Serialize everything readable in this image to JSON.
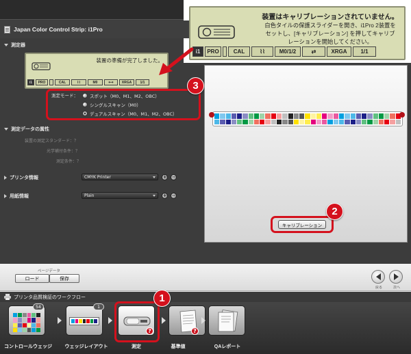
{
  "window": {
    "title": "Japan Color Control Strip: i1Pro"
  },
  "instrument": {
    "section_label": "測定器",
    "status_small": "装置の準備が完了しました。",
    "status_big_title": "装置はキャリブレーションされていません。",
    "status_big_body_1": "白色タイルの保護スライダーを開き、i1Pro 2装置を",
    "status_big_body_2": "セットし、[キャリブレーション] を押してキャリブ",
    "status_big_body_3": "レーションを開始してください。",
    "bar": {
      "model_short": "i1",
      "model": "PRO",
      "cal": "CAL",
      "m_mode": "M0",
      "m_mode_big": "M0/1/2",
      "xrga": "XRGA",
      "page": "1/1"
    }
  },
  "measurement_mode": {
    "label": "測定モード：",
    "options": [
      {
        "label": "スポット（M0、M1、M2、OBC）",
        "selected": false
      },
      {
        "label": "シングルスキャン（M0）",
        "selected": false
      },
      {
        "label": "デュアルスキャン（M0、M1、M2、OBC）",
        "selected": true
      }
    ]
  },
  "measurement_data": {
    "section_label": "測定データの属性",
    "rows": [
      "装置の測定スタンダード：？",
      "光学補付条件：？",
      "測定条件：？"
    ]
  },
  "printer": {
    "section_label": "プリンタ情報",
    "value": "CMYK Printer"
  },
  "paper": {
    "section_label": "用紙情報",
    "value": "Plain"
  },
  "calibrate_button": "キャリブレーション",
  "page_data": {
    "label": "ページデータ",
    "load": "ロード",
    "save": "保存"
  },
  "nav": {
    "back": "戻る",
    "next": "次へ"
  },
  "workflow": {
    "title": "プリンタ品質検証のワークフロー",
    "steps": [
      {
        "label": "コントロールウェッジ",
        "badge": "54"
      },
      {
        "label": "ウェッジレイアウト",
        "badge": "1"
      },
      {
        "label": "測定",
        "badge": ""
      },
      {
        "label": "基準値",
        "badge": ""
      },
      {
        "label": "QAレポート",
        "badge": ""
      }
    ]
  },
  "callouts": [
    "1",
    "2",
    "3"
  ],
  "colors": {
    "accent_red": "#d4111d",
    "lcd_green": "#d9ddb4",
    "panel_dark": "#3c3c3c"
  },
  "icons": [
    "document-icon",
    "projector-icon",
    "printer-icon",
    "back-arrow-icon",
    "next-arrow-icon",
    "question-icon"
  ]
}
